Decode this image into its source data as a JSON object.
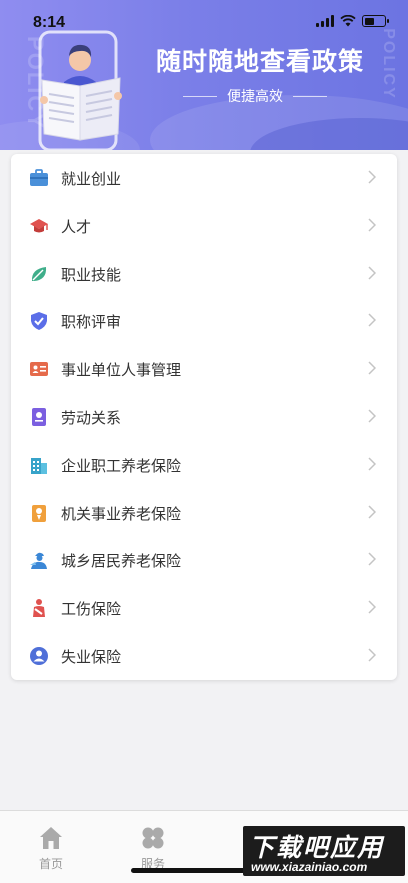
{
  "status_bar": {
    "time": "8:14"
  },
  "header": {
    "watermark_left": "POLICY",
    "watermark_right": "POLICY",
    "title": "随时随地查看政策",
    "subtitle": "便捷高效"
  },
  "menu": {
    "items": [
      {
        "label": "就业创业",
        "icon": "briefcase-icon",
        "color": "#4a90d9"
      },
      {
        "label": "人才",
        "icon": "graduation-cap-icon",
        "color": "#e0524f"
      },
      {
        "label": "职业技能",
        "icon": "leaf-icon",
        "color": "#3fae8a"
      },
      {
        "label": "职称评审",
        "icon": "shield-check-icon",
        "color": "#5b6ee8"
      },
      {
        "label": "事业单位人事管理",
        "icon": "id-card-icon",
        "color": "#e56a4b"
      },
      {
        "label": "劳动关系",
        "icon": "contract-icon",
        "color": "#7b5fe0"
      },
      {
        "label": "企业职工养老保险",
        "icon": "building-icon",
        "color": "#37a3c9"
      },
      {
        "label": "机关事业养老保险",
        "icon": "badge-person-icon",
        "color": "#f0a03c"
      },
      {
        "label": "城乡居民养老保险",
        "icon": "worker-icon",
        "color": "#3b87d6"
      },
      {
        "label": "工伤保险",
        "icon": "injured-person-icon",
        "color": "#e0524f"
      },
      {
        "label": "失业保险",
        "icon": "person-circle-icon",
        "color": "#4f6fd8"
      }
    ]
  },
  "tabbar": {
    "tabs": [
      {
        "label": "首页",
        "icon": "home-icon"
      },
      {
        "label": "服务",
        "icon": "clover-grid-icon"
      }
    ]
  },
  "watermark": {
    "text": "下载吧应用",
    "url": "www.xiazainiao.com"
  }
}
